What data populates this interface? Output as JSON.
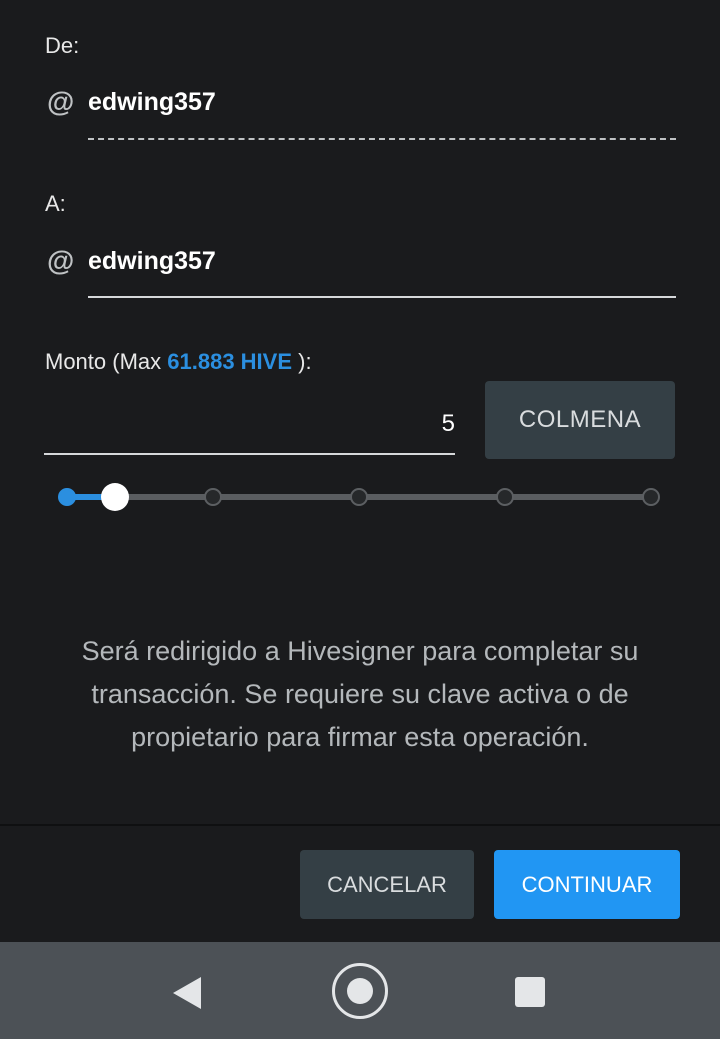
{
  "from": {
    "label": "De:",
    "username": "edwing357"
  },
  "to": {
    "label": "A:",
    "username": "edwing357"
  },
  "amount": {
    "label_prefix": "Monto (Max ",
    "max_value": "61.883 HIVE",
    "label_suffix": " ):",
    "value": "5",
    "asset_button": "COLMENA",
    "slider_steps": 6,
    "slider_value_fraction": 0.08
  },
  "info_text": "Será redirigido a Hivesigner para completar su transacción. Se requiere su clave activa o de propietario para firmar esta operación.",
  "actions": {
    "cancel": "CANCELAR",
    "continue": "CONTINUAR"
  },
  "icons": {
    "at": "@"
  },
  "colors": {
    "accent": "#2196f3",
    "background": "#1a1b1d",
    "secondary_button": "#343f45"
  }
}
